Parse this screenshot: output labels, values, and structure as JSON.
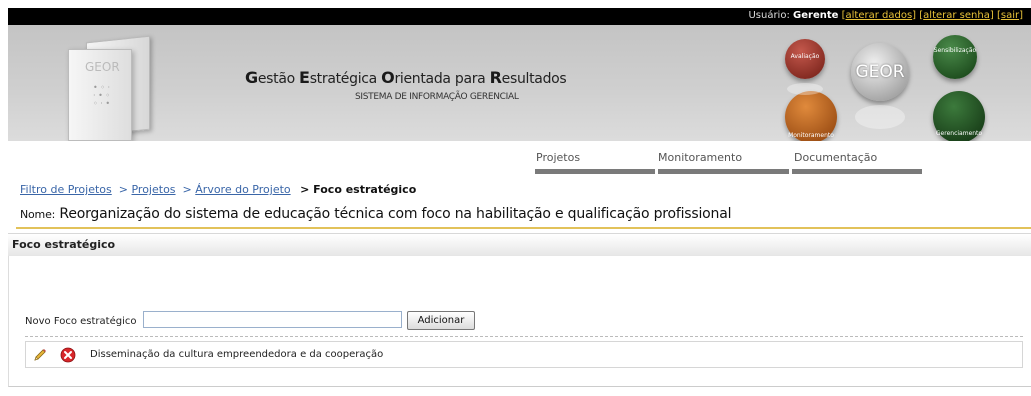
{
  "topbar": {
    "user_label": "Usuário:",
    "user_name": "Gerente",
    "links": [
      "alterar dados",
      "alterar senha",
      "sair"
    ]
  },
  "header": {
    "logo_text": "GEOR",
    "title_parts": [
      {
        "cap": "G",
        "rest": "estão "
      },
      {
        "cap": "E",
        "rest": "stratégica "
      },
      {
        "cap": "O",
        "rest": "rientada para "
      },
      {
        "cap": "R",
        "rest": "esultados"
      }
    ],
    "subtitle": "SISTEMA DE INFORMAÇÃO GERENCIAL",
    "circles": {
      "avaliacao": "Avaliação",
      "geor": "GEOR",
      "sensibilizacao": "Sensibilização",
      "monitoramento": "Monitoramento",
      "gerenciamento": "Gerenciamento"
    },
    "colors": {
      "avaliacao": "#8b2a20",
      "sensibilizacao": "#1e4d1e",
      "monitoramento": "#b05a17",
      "gerenciamento": "#1a3f1a"
    }
  },
  "nav": {
    "items": [
      "Projetos",
      "Monitoramento",
      "Documentação"
    ]
  },
  "breadcrumb": {
    "links": [
      "Filtro de Projetos",
      "Projetos",
      "Árvore do Projeto"
    ],
    "current": "Foco estratégico"
  },
  "project": {
    "label": "Nome:",
    "name": "Reorganização do sistema de educação técnica com foco na habilitação e qualificação profissional"
  },
  "section": {
    "title": "Foco estratégico"
  },
  "form": {
    "label": "Novo Foco estratégico",
    "input_value": "",
    "button_label": "Adicionar"
  },
  "items": [
    {
      "text": "Disseminação da cultura empreendedora e da cooperação",
      "edit_icon": "pencil-icon",
      "delete_icon": "delete-icon"
    }
  ]
}
